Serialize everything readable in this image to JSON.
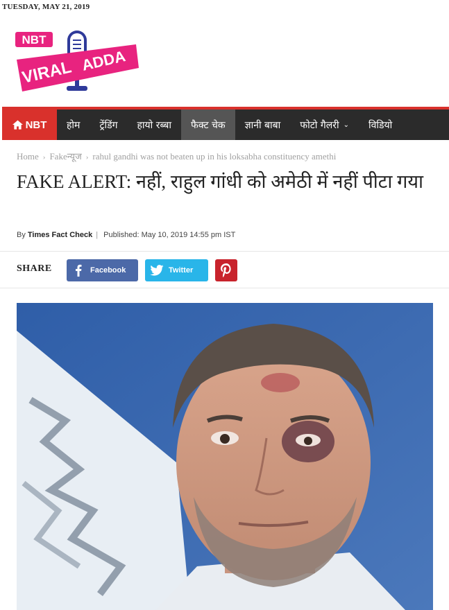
{
  "date": "TUESDAY, MAY 21, 2019",
  "logo": {
    "nbt": "NBT",
    "viral": "VIRAL",
    "adda": "ADDA"
  },
  "nav": {
    "home_badge": "NBT",
    "items": [
      {
        "label": "होम"
      },
      {
        "label": "ट्रेंडिंग"
      },
      {
        "label": "हायो रब्बा"
      },
      {
        "label": "फैक्ट चेक"
      },
      {
        "label": "ज्ञानी बाबा"
      },
      {
        "label": "फोटो गैलरी"
      },
      {
        "label": "विडियो"
      }
    ]
  },
  "breadcrumb": [
    "Home",
    "Fakeन्यूज",
    "rahul gandhi was not beaten up in his loksabha constituency amethi"
  ],
  "article": {
    "title": "FAKE ALERT: नहीं, राहुल गांधी को अमेठी में नहीं पीटा गया",
    "by_prefix": "By",
    "author": "Times Fact Check",
    "published": "Published: May 10, 2019 14:55 pm IST"
  },
  "share": {
    "label": "SHARE",
    "facebook": "Facebook",
    "twitter": "Twitter"
  },
  "colors": {
    "accent": "#d9312c",
    "nav_bg": "#2b2b2b",
    "facebook": "#4c69a8",
    "twitter": "#29b5e9",
    "pinterest": "#c8232c",
    "logo_pink": "#e8237f",
    "logo_blue": "#2f3a9a"
  },
  "icons": [
    "home-icon",
    "facebook-icon",
    "twitter-icon",
    "pinterest-icon",
    "microphone-icon",
    "chevron-down-icon"
  ]
}
